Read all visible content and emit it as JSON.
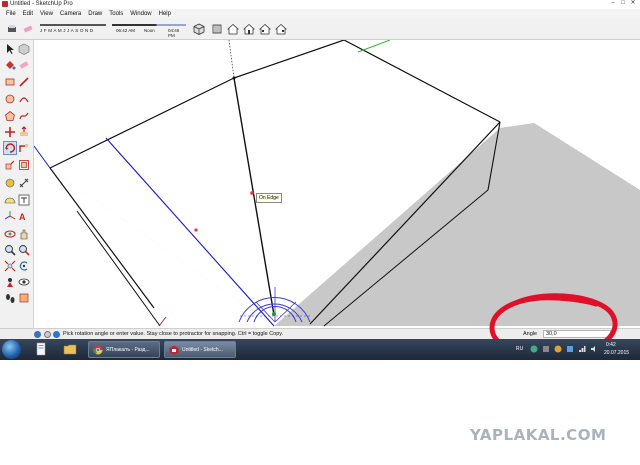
{
  "window": {
    "title": "Untitled - SketchUp Pro",
    "controls": [
      "–",
      "□",
      "✕"
    ]
  },
  "menu": [
    "File",
    "Edit",
    "View",
    "Camera",
    "Draw",
    "Tools",
    "Window",
    "Help"
  ],
  "shadow_settings": {
    "months": "J F M A M J J A S O N D",
    "time_start": "06:42 AM",
    "time_mid": "Noon",
    "time_end": "04:46 PM"
  },
  "tooltip": "On Edge",
  "status": {
    "hint": "Pick rotation angle or enter value.  Stay close to protractor for snapping. Ctrl = toggle Copy.",
    "measure_label": "Angle",
    "measure_value": "30,0"
  },
  "taskbar": {
    "items": [
      {
        "label": "ЯПлакалъ - Разд...",
        "icon": "chrome-icon"
      },
      {
        "label": "Untitled - Sketch...",
        "icon": "sketchup-icon"
      }
    ],
    "language": "RU",
    "clock_time": "0:42",
    "clock_date": "20.07.2015"
  },
  "watermark": "YAPLAKAL.COM",
  "colors": {
    "annotation": "#e0102a",
    "blue_edge": "#1a1acf",
    "protractor": "#3b3bd0",
    "green_axis": "#2bb12b"
  },
  "icons": {
    "toolbar": [
      "print-icon",
      "eraser-icon",
      "shadow-icon",
      "fog-icon",
      "iso-view-icon",
      "top-view-icon",
      "front-view-icon",
      "right-view-icon",
      "back-view-icon",
      "left-view-icon",
      "home-view-icon"
    ],
    "palette": [
      "select-icon",
      "make-component-icon",
      "paint-bucket-icon",
      "eraser-icon",
      "rectangle-icon",
      "line-icon",
      "circle-icon",
      "arc-icon",
      "polygon-icon",
      "freehand-icon",
      "move-icon",
      "push-pull-icon",
      "rotate-icon",
      "follow-me-icon",
      "scale-icon",
      "offset-icon",
      "tape-measure-icon",
      "dimension-icon",
      "protractor-icon",
      "text-icon",
      "axes-icon",
      "3d-text-icon",
      "orbit-icon",
      "pan-icon",
      "zoom-icon",
      "zoom-window-icon",
      "zoom-extents-icon",
      "previous-view-icon",
      "position-camera-icon",
      "look-around-icon",
      "walk-icon",
      "section-plane-icon"
    ]
  }
}
